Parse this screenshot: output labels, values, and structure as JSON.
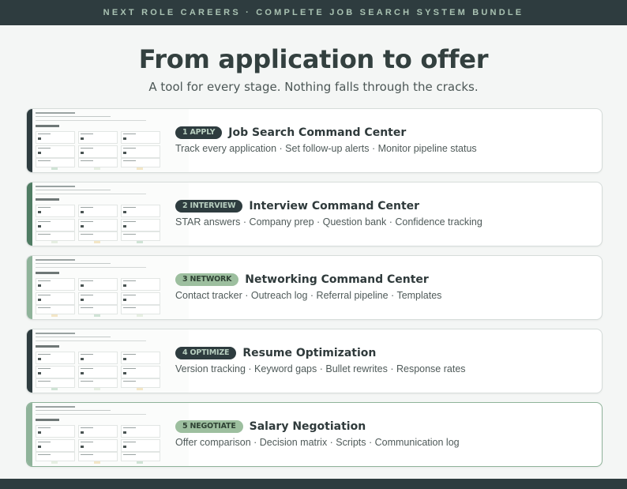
{
  "header": {
    "banner": "NEXT ROLE CAREERS  ·  COMPLETE JOB SEARCH SYSTEM BUNDLE"
  },
  "hero": {
    "title": "From application to offer",
    "subtitle": "A tool for every stage. Nothing falls through the cracks."
  },
  "stages": [
    {
      "badge": "1 APPLY",
      "title": "Job Search Command Center",
      "description": "Track every application · Set follow-up alerts · Monitor pipeline status",
      "accent_color": "#2e3c3f",
      "badge_style": "dark"
    },
    {
      "badge": "2 INTERVIEW",
      "title": "Interview Command Center",
      "description": "STAR answers · Company prep · Question bank · Confidence tracking",
      "accent_color": "#4f7c63",
      "badge_style": "dark"
    },
    {
      "badge": "3 NETWORK",
      "title": "Networking Command Center",
      "description": "Contact tracker · Outreach log · Referral pipeline · Templates",
      "accent_color": "#8fb39a",
      "badge_style": "green"
    },
    {
      "badge": "4 OPTIMIZE",
      "title": "Resume Optimization",
      "description": "Version tracking · Keyword gaps · Bullet rewrites · Response rates",
      "accent_color": "#2e3c3f",
      "badge_style": "dark"
    },
    {
      "badge": "5 NEGOTIATE",
      "title": "Salary Negotiation",
      "description": "Offer comparison · Decision matrix · Scripts · Communication log",
      "accent_color": "#8fb39a",
      "badge_style": "green"
    }
  ]
}
